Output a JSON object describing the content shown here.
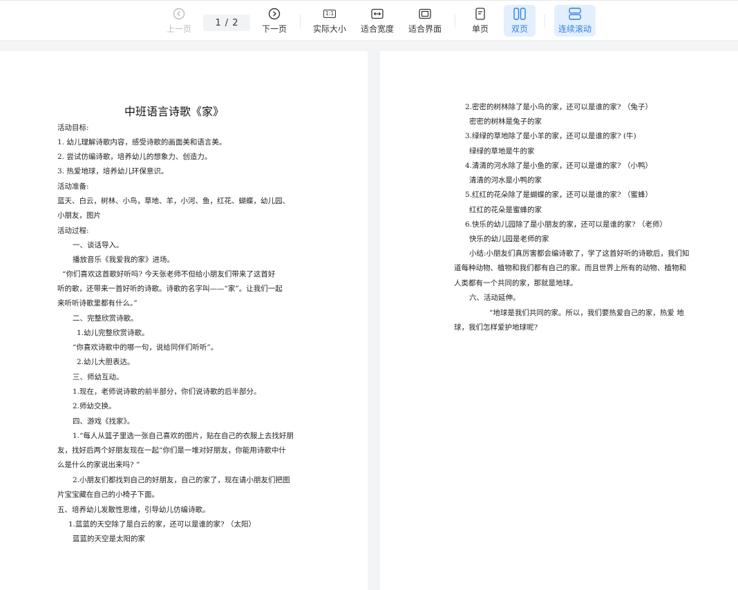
{
  "toolbar": {
    "prev_label": "上一页",
    "page_current": "1",
    "page_sep": "/",
    "page_total": "2",
    "next_label": "下一页",
    "actual_size_label": "实际大小",
    "actual_size_icon_text": "1:1",
    "fit_width_label": "适合宽度",
    "fit_page_label": "适合界面",
    "single_label": "单页",
    "double_label": "双页",
    "scroll_label": "连续滚动"
  },
  "colors": {
    "accent": "#2f7fe0",
    "active_bg": "#e3effd",
    "disabled": "#b9bcc2"
  },
  "page1": {
    "title": "中班语言诗歌《家》",
    "lines": [
      "活动目标:",
      "1.  幼儿理解诗歌内容，感受诗歌的画面美和语言美。",
      "2.  尝试仿编诗歌，培养幼儿的想象力、创造力。",
      "3.  热爱地球，培养幼儿环保意识。",
      "活动准备:",
      "蓝天、白云，树林、小鸟，草地、羊，小河、鱼，红花、蝴蝶，幼儿园、",
      "小朋友，图片",
      "活动过程:",
      "一、谈话导入。",
      "播放音乐《我爱我的家》进场。",
      "“你们喜欢这首歌好听吗? 今天张老师不但给小朋友们带来了这首好",
      "听的歌，还带来一首好听的诗歌。诗歌的名字叫——“家”。让我们一起",
      "来听听诗歌里都有什么。”",
      "二、完整欣赏诗歌。",
      "1.幼儿完整欣赏诗歌。",
      "“你喜欢诗歌中的哪一句，说给同伴们听听”。",
      "2.幼儿大胆表达。",
      "三、师幼互动。",
      "1.现在，老师说诗歌的前半部分，你们说诗歌的后半部分。",
      "2.师幼交换。",
      "四、游戏《找家》。",
      "1.“每人从篮子里选一张自己喜欢的图片，贴在自己的衣服上去找好朋",
      "友，找好后两个好朋友现在一起“你们是一堆对好朋友，你能用诗歌中什",
      "么是什么的家说出来吗? ”",
      "2.小朋友们都找到自己的好朋友，自己的家了，现在请小朋友们把图",
      "片宝宝藏在自己的小椅子下面。",
      "五、培养幼儿发散性思维，引导幼儿仿编诗歌。",
      "1.蓝蓝的天空除了是白云的家，还可以是谁的家? （太阳）",
      "蓝蓝的天空是太阳的家"
    ]
  },
  "page2": {
    "lines": [
      "2.密密的树林除了是小鸟的家，还可以是谁的家? （兔子）",
      "密密的树林是兔子的家",
      "3.绿绿的草地除了是小羊的家，还可以是谁的家? (牛)",
      "绿绿的草地是牛的家",
      "4.清清的河水除了是小鱼的家，还可以是谁的家? （小鸭）",
      "清清的河水是小鸭的家",
      "5.红红的花朵除了是蝴蝶的家，还可以是谁的家? （蜜蜂）",
      "红红的花朵是蜜蜂的家",
      "6.快乐的幼儿园除了是小朋友的家，还可以是谁的家?          （老师）",
      "快乐的幼儿园是老师的家",
      "小结:小朋友们真厉害都会编诗歌了，学了这首好听的诗歌后，我们知",
      "道每种动物、植物和我们都有自己的家。而且世界上所有的动物、植物和",
      "人类都有一个共同的家，那就是地球。",
      "六、活动延伸。",
      "“地球是我们共同的家。所以，我们要热爱自己的家，热爱  地",
      "球，我们怎样爱护地球呢?"
    ]
  }
}
